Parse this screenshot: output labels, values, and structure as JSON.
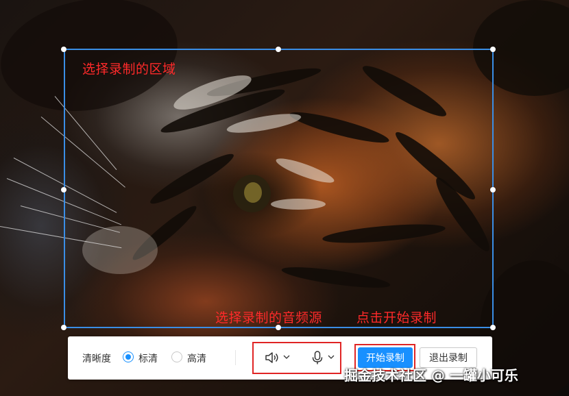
{
  "annotations": {
    "select_region": "选择录制的区域",
    "select_audio": "选择录制的音频源",
    "click_start": "点击开始录制"
  },
  "toolbar": {
    "clarity_label": "清晰度",
    "clarity_options": [
      {
        "label": "标清",
        "selected": true
      },
      {
        "label": "高清",
        "selected": false
      }
    ],
    "audio_sources": [
      {
        "icon": "speaker-icon",
        "dropdown": "chevron-down-icon"
      },
      {
        "icon": "microphone-icon",
        "dropdown": "chevron-down-icon"
      }
    ],
    "start_button": "开始录制",
    "exit_button": "退出录制"
  },
  "watermark": "掘金技术社区 @ 一罐小可乐",
  "colors": {
    "selection_border": "#3a8ee6",
    "annotation_text": "#ff2a2a",
    "highlight_box": "#e02424",
    "primary": "#1890ff"
  }
}
